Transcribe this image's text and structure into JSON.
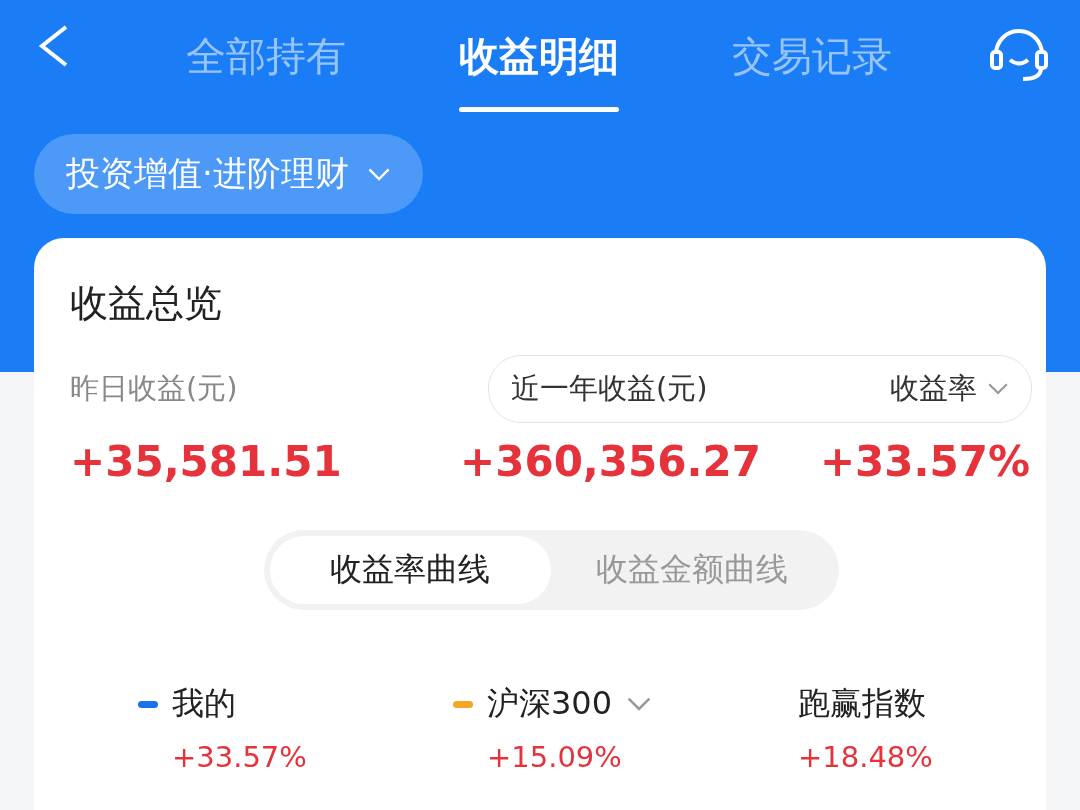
{
  "tabs": [
    {
      "label": "全部持有",
      "selected": false
    },
    {
      "label": "收益明细",
      "selected": true
    },
    {
      "label": "交易记录",
      "selected": false
    }
  ],
  "product_selector": {
    "label": "投资增值·进阶理财"
  },
  "overview": {
    "title": "收益总览",
    "yesterday": {
      "label": "昨日收益(元)",
      "value": "+35,581.51"
    },
    "year": {
      "label": "近一年收益(元)",
      "value": "+360,356.27"
    },
    "rate": {
      "label": "收益率",
      "value": "+33.57%"
    }
  },
  "curve_tabs": [
    {
      "label": "收益率曲线",
      "selected": true
    },
    {
      "label": "收益金额曲线",
      "selected": false
    }
  ],
  "legend": [
    {
      "label": "我的",
      "value": "+33.57%",
      "color": "#1a73e8",
      "dropdown": false
    },
    {
      "label": "沪深300",
      "value": "+15.09%",
      "color": "#f5a623",
      "dropdown": true
    },
    {
      "label": "跑赢指数",
      "value": "+18.48%",
      "dropdown": false
    }
  ]
}
